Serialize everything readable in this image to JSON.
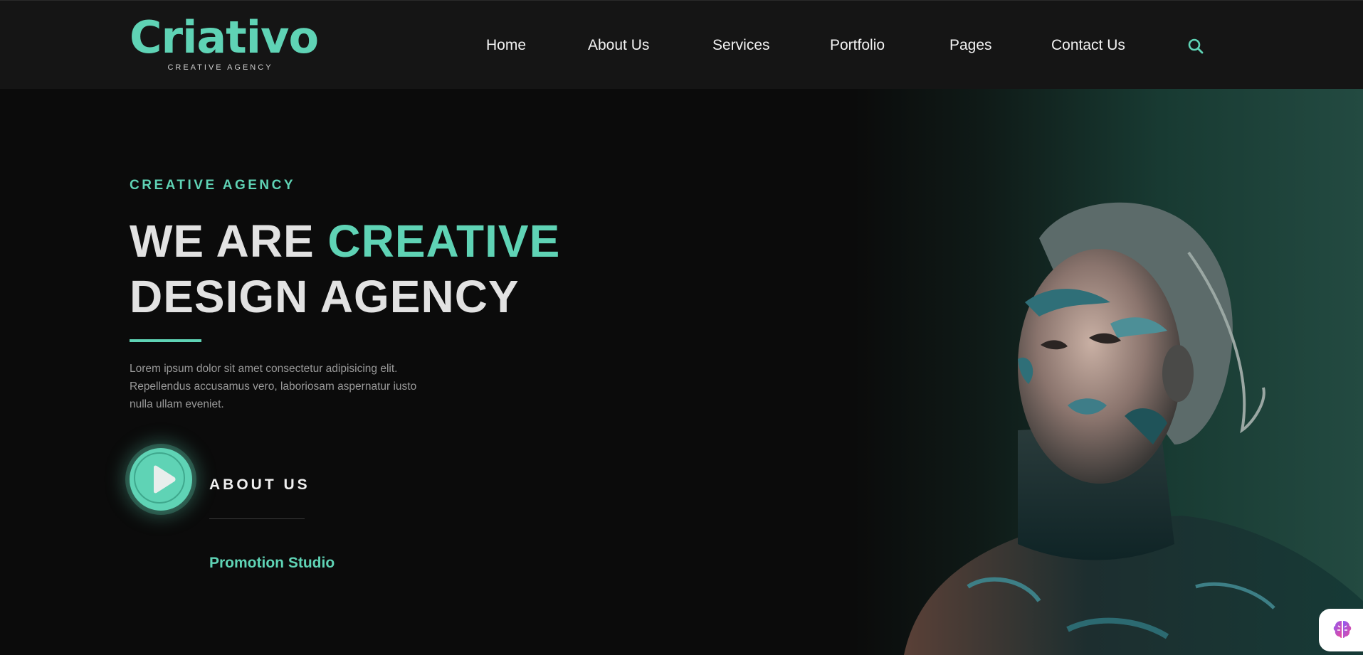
{
  "brand": {
    "name": "Criativo",
    "tagline": "CREATIVE AGENCY"
  },
  "nav": {
    "items": [
      {
        "label": "Home"
      },
      {
        "label": "About Us"
      },
      {
        "label": "Services"
      },
      {
        "label": "Portfolio"
      },
      {
        "label": "Pages"
      },
      {
        "label": "Contact Us"
      }
    ],
    "search_icon": "search-icon"
  },
  "hero": {
    "eyebrow": "CREATIVE AGENCY",
    "headline_part1": "WE ARE ",
    "headline_accent": "CREATIVE",
    "headline_line2": "DESIGN AGENCY",
    "paragraph": "Lorem ipsum dolor sit amet consectetur adipisicing elit. Repellendus accusamus vero, laboriosam aspernatur iusto nulla ullam eveniet.",
    "about_label": "ABOUT US",
    "promo_label": "Promotion Studio",
    "play_icon": "play-icon",
    "image": "portrait of woman with teal face paint"
  },
  "colors": {
    "accent": "#5fd3b5",
    "background": "#0b0b0b",
    "header": "#151515",
    "text": "#e2e2e2"
  }
}
